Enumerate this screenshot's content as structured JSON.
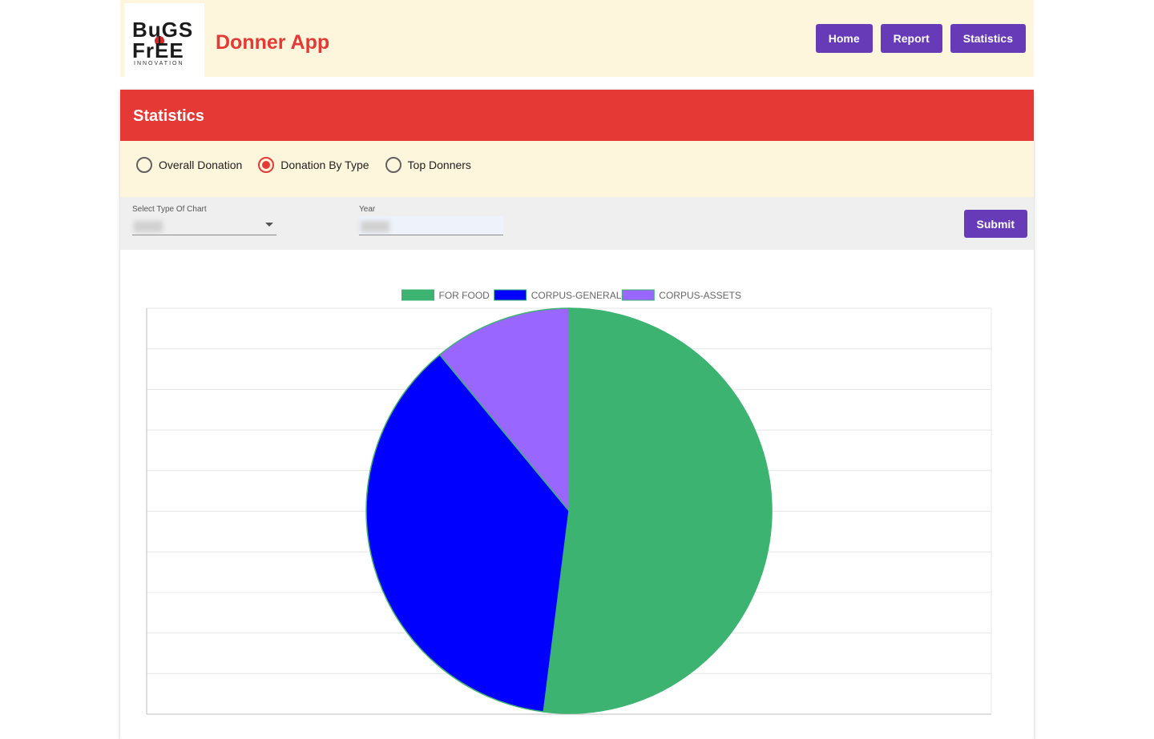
{
  "header": {
    "logo": {
      "line1": "BuGS",
      "line2": "FrEE",
      "sub": "INNOVATION"
    },
    "app_title": "Donner App",
    "nav": [
      "Home",
      "Report",
      "Statistics"
    ]
  },
  "card": {
    "title": "Statistics",
    "radios": [
      {
        "label": "Overall Donation",
        "checked": false
      },
      {
        "label": "Donation By Type",
        "checked": true
      },
      {
        "label": "Top Donners",
        "checked": false
      }
    ],
    "filters": {
      "chart_type_label": "Select Type Of Chart",
      "year_label": "Year",
      "submit_label": "Submit"
    }
  },
  "colors": {
    "brand_red": "#e53935",
    "brand_purple": "#673ab7",
    "header_bg": "#fdf6dc"
  },
  "chart_data": {
    "type": "pie",
    "title": "",
    "legend_position": "top",
    "grid": true,
    "series": [
      {
        "name": "FOR FOOD",
        "value": 52,
        "color": "#3cb371"
      },
      {
        "name": "CORPUS-GENERAL",
        "value": 37,
        "color": "#0000ff"
      },
      {
        "name": "CORPUS-ASSETS",
        "value": 11,
        "color": "#9966ff"
      }
    ]
  }
}
